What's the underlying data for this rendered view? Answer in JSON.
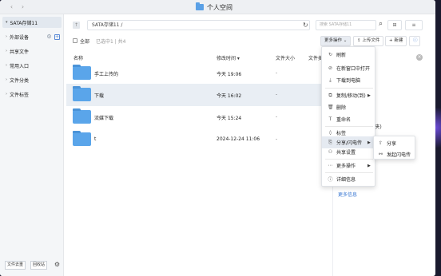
{
  "window": {
    "title": "个人空间"
  },
  "nav": {
    "back": "‹",
    "forward": "›"
  },
  "sidebar": {
    "items": [
      {
        "label": "SATA存储11",
        "expanded": true
      },
      {
        "label": "外部设备"
      },
      {
        "label": "共享文件"
      },
      {
        "label": "常用入口"
      },
      {
        "label": "文件分类"
      },
      {
        "label": "文件标签"
      }
    ],
    "bottom": {
      "file_export": "文件去重",
      "recycle": "回收站"
    }
  },
  "toolbar": {
    "path": "SATA存储11 /",
    "search_placeholder": "搜索 SATA存储11",
    "view_grid": "⊞",
    "view_list": "≡"
  },
  "actionbar": {
    "select_all": "全部",
    "selection_info": "已选中1 | 共4",
    "more_actions": "更多操作",
    "upload": "上传文件",
    "new": "+ 新建",
    "info": "ⓘ"
  },
  "columns": {
    "name": "名称",
    "modified": "修改时间",
    "size": "文件大小",
    "type": "文件类"
  },
  "files": [
    {
      "name": "手工上传的",
      "modified": "今天 19:06",
      "size": "-"
    },
    {
      "name": "下载",
      "modified": "今天 16:02",
      "size": "-"
    },
    {
      "name": "流媒下载",
      "modified": "今天 15:24",
      "size": "-"
    },
    {
      "name": "t",
      "modified": "2024-12-24 11:06",
      "size": "-"
    }
  ],
  "context_menu": {
    "items": [
      {
        "label": "刷新",
        "icon": "refresh-icon"
      },
      {
        "label": "在新窗口中打开",
        "icon": "open-window-icon"
      },
      {
        "label": "下载到电脑",
        "icon": "download-icon"
      },
      {
        "label": "复制/移动(到)",
        "icon": "copy-icon"
      },
      {
        "label": "删除",
        "icon": "delete-icon"
      },
      {
        "label": "重命名",
        "icon": "rename-icon"
      },
      {
        "label": "标签",
        "icon": "tag-icon"
      },
      {
        "label": "分享/闪电传",
        "icon": "share-icon"
      },
      {
        "label": "共享设置",
        "icon": "share-settings-icon"
      },
      {
        "label": "更多操作",
        "icon": "more-icon"
      },
      {
        "label": "详细信息",
        "icon": "info-icon"
      }
    ]
  },
  "submenu": {
    "items": [
      {
        "label": "分享"
      },
      {
        "label": "发起闪电传"
      }
    ]
  },
  "detail": {
    "type": "(文件夹)",
    "more": "更多信息"
  }
}
